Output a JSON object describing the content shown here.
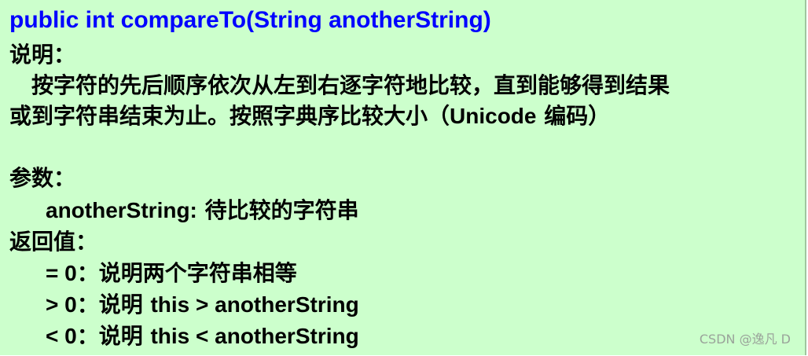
{
  "signature": "public  int  compareTo(String  anotherString)",
  "description": {
    "label": "说明：",
    "line1": "按字符的先后顺序依次从左到右逐字符地比较，直到能够得到结果",
    "line2_prefix": "或到字符串结束为止。按照字典序比较大小（",
    "line2_latin": "Unicode",
    "line2_suffix": " 编码）"
  },
  "params": {
    "label": "参数：",
    "name": "anotherString:",
    "text": " 待比较的字符串"
  },
  "returns": {
    "label": "返回值：",
    "items": [
      {
        "cond": "= 0",
        "sep": "：说明两个字符串相等",
        "tail": ""
      },
      {
        "cond": "> 0",
        "sep": "：说明 ",
        "tail": "this > anotherString"
      },
      {
        "cond": "< 0",
        "sep": "：说明 ",
        "tail": "this < anotherString"
      }
    ]
  },
  "watermark": "CSDN @逸凡 D",
  "colors": {
    "background": "#ccffcc",
    "signature": "#0000ff",
    "text": "#000000"
  }
}
